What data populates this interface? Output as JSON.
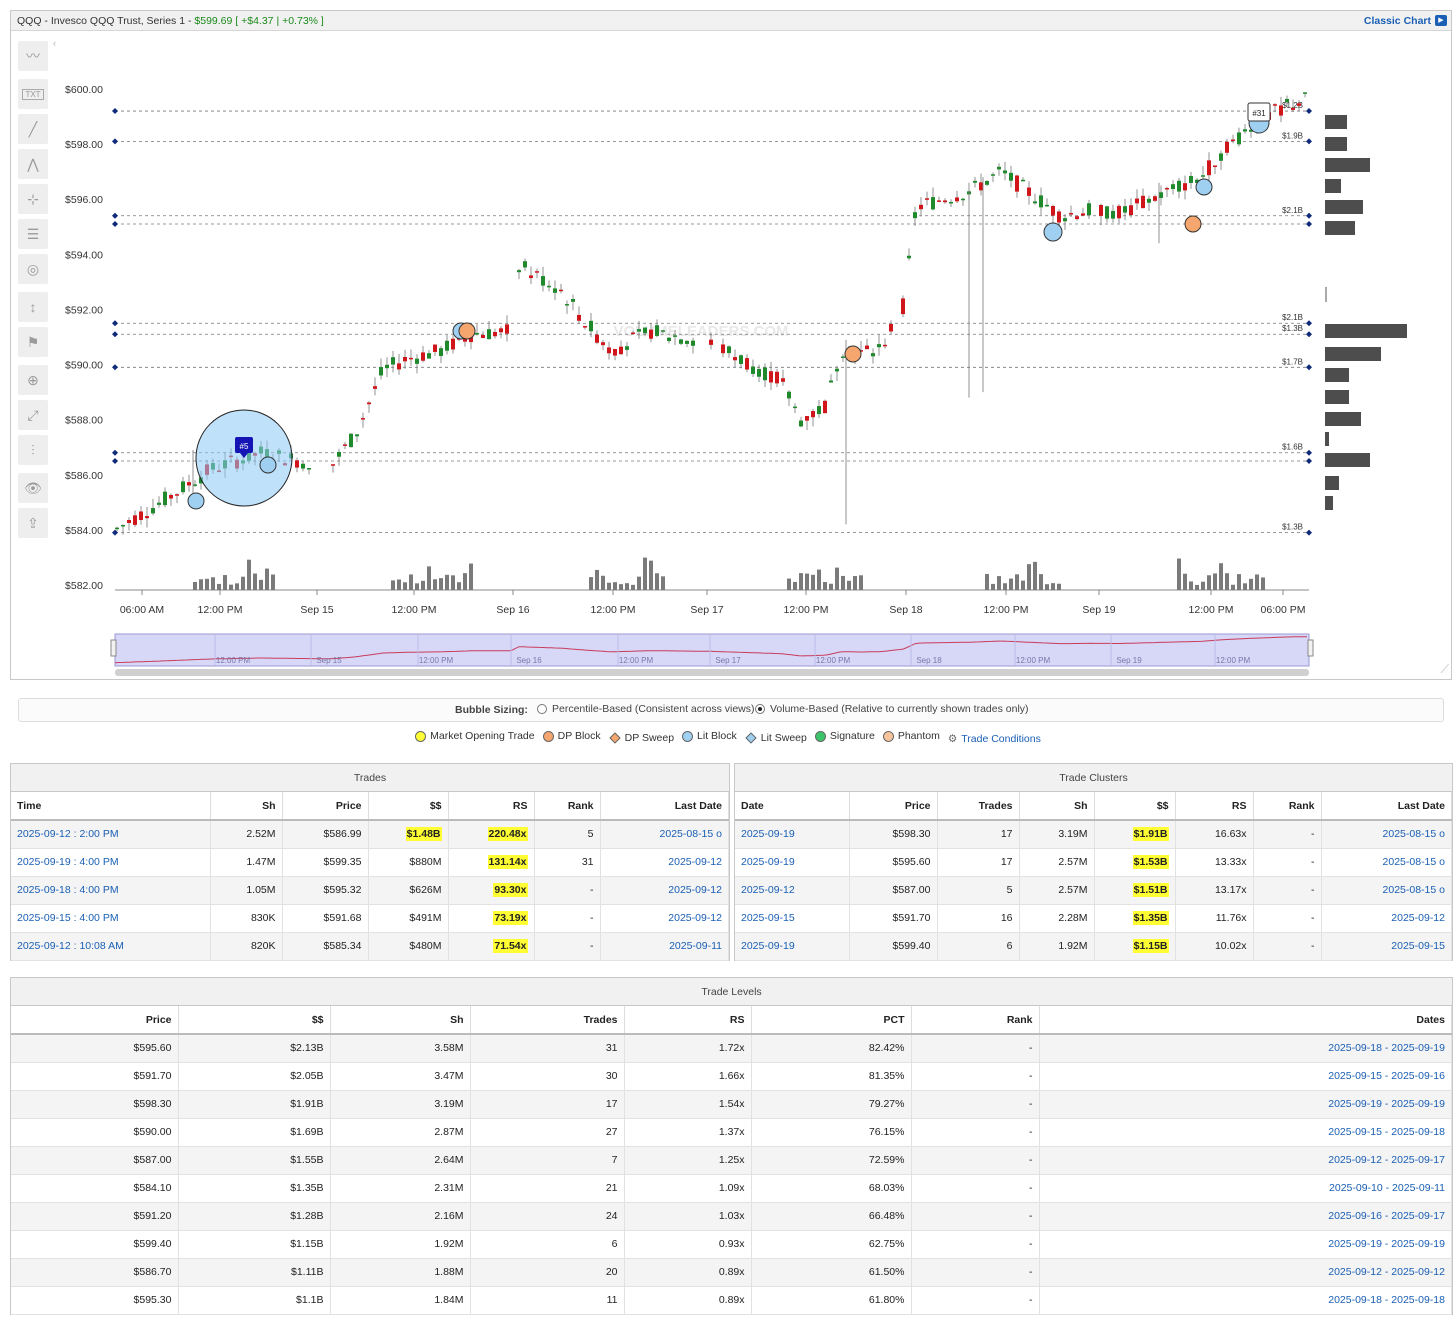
{
  "header": {
    "symbol_name": "QQQ - Invesco QQQ Trust, Series 1 - ",
    "price": "$599.69",
    "change": "[ +$4.37 | +0.73% ]",
    "classic_chart": "Classic Chart"
  },
  "chart_data": {
    "type": "candlestick",
    "y_ticks": [
      "$600.00",
      "$598.00",
      "$596.00",
      "$594.00",
      "$592.00",
      "$590.00",
      "$588.00",
      "$586.00",
      "$584.00",
      "$582.00"
    ],
    "x_ticks": [
      "06:00 AM",
      "12:00 PM",
      "Sep 15",
      "12:00 PM",
      "Sep 16",
      "12:00 PM",
      "Sep 17",
      "12:00 PM",
      "Sep 18",
      "12:00 PM",
      "Sep 19",
      "12:00 PM",
      "06:00 PM"
    ],
    "navigator_ticks": [
      "12:00 PM",
      "Sep 15",
      "12:00 PM",
      "Sep 16",
      "12:00 PM",
      "Sep 17",
      "12:00 PM",
      "Sep 18",
      "12:00 PM",
      "Sep 19",
      "12:00 PM"
    ],
    "ylim": [
      582,
      600
    ],
    "levels": [
      {
        "price": 599.2,
        "label": "$1.2B"
      },
      {
        "price": 598.1,
        "label": "$1.9B"
      },
      {
        "price": 595.4,
        "label": "$2.1B"
      },
      {
        "price": 595.1,
        "label": ""
      },
      {
        "price": 591.5,
        "label": "$2.1B"
      },
      {
        "price": 591.1,
        "label": "$1.3B"
      },
      {
        "price": 589.9,
        "label": "$1.7B"
      },
      {
        "price": 586.8,
        "label": "$1.6B"
      },
      {
        "price": 586.5,
        "label": ""
      },
      {
        "price": 583.9,
        "label": "$1.3B"
      }
    ],
    "markers": [
      {
        "label": "#5",
        "price": 586.9
      },
      {
        "label": "#31",
        "price": 599.6
      }
    ],
    "watermark": "VOLUMELEADERS.COM"
  },
  "bubble_sizing": {
    "label": "Bubble Sizing:",
    "option1": "Percentile-Based (Consistent across views)",
    "option2": "Volume-Based (Relative to currently shown trades only)"
  },
  "legend": [
    {
      "label": "Market Opening Trade",
      "color": "#ffff33",
      "shape": "circle"
    },
    {
      "label": "DP Block",
      "color": "#f5a66e",
      "shape": "circle"
    },
    {
      "label": "DP Sweep",
      "color": "#f5a66e",
      "shape": "diamond"
    },
    {
      "label": "Lit Block",
      "color": "#9fd0f2",
      "shape": "circle"
    },
    {
      "label": "Lit Sweep",
      "color": "#9fd0f2",
      "shape": "diamond"
    },
    {
      "label": "Signature",
      "color": "#3cc46a",
      "shape": "circle"
    },
    {
      "label": "Phantom",
      "color": "#f5c49a",
      "shape": "phantom"
    },
    {
      "label": "Trade Conditions",
      "shape": "gear"
    }
  ],
  "trades": {
    "title": "Trades",
    "columns": [
      "Time",
      "Sh",
      "Price",
      "$$",
      "RS",
      "Rank",
      "Last Date"
    ],
    "rows": [
      [
        "2025-09-12 : 2:00 PM",
        "2.52M",
        "$586.99",
        "$1.48B",
        "220.48x",
        "5",
        "2025-08-15 o"
      ],
      [
        "2025-09-19 : 4:00 PM",
        "1.47M",
        "$599.35",
        "$880M",
        "131.14x",
        "31",
        "2025-09-12"
      ],
      [
        "2025-09-18 : 4:00 PM",
        "1.05M",
        "$595.32",
        "$626M",
        "93.30x",
        "-",
        "2025-09-12"
      ],
      [
        "2025-09-15 : 4:00 PM",
        "830K",
        "$591.68",
        "$491M",
        "73.19x",
        "-",
        "2025-09-12"
      ],
      [
        "2025-09-12 : 10:08 AM",
        "820K",
        "$585.34",
        "$480M",
        "71.54x",
        "-",
        "2025-09-11"
      ]
    ]
  },
  "clusters": {
    "title": "Trade Clusters",
    "columns": [
      "Date",
      "Price",
      "Trades",
      "Sh",
      "$$",
      "RS",
      "Rank",
      "Last Date"
    ],
    "rows": [
      [
        "2025-09-19",
        "$598.30",
        "17",
        "3.19M",
        "$1.91B",
        "16.63x",
        "-",
        "2025-08-15 o"
      ],
      [
        "2025-09-19",
        "$595.60",
        "17",
        "2.57M",
        "$1.53B",
        "13.33x",
        "-",
        "2025-08-15 o"
      ],
      [
        "2025-09-12",
        "$587.00",
        "5",
        "2.57M",
        "$1.51B",
        "13.17x",
        "-",
        "2025-08-15 o"
      ],
      [
        "2025-09-15",
        "$591.70",
        "16",
        "2.28M",
        "$1.35B",
        "11.76x",
        "-",
        "2025-09-12"
      ],
      [
        "2025-09-19",
        "$599.40",
        "6",
        "1.92M",
        "$1.15B",
        "10.02x",
        "-",
        "2025-09-15"
      ]
    ]
  },
  "levels_table": {
    "title": "Trade Levels",
    "columns": [
      "Price",
      "$$",
      "Sh",
      "Trades",
      "RS",
      "PCT",
      "Rank",
      "Dates"
    ],
    "rows": [
      [
        "$595.60",
        "$2.13B",
        "3.58M",
        "31",
        "1.72x",
        "82.42%",
        "-",
        "2025-09-18 - 2025-09-19"
      ],
      [
        "$591.70",
        "$2.05B",
        "3.47M",
        "30",
        "1.66x",
        "81.35%",
        "-",
        "2025-09-15 - 2025-09-16"
      ],
      [
        "$598.30",
        "$1.91B",
        "3.19M",
        "17",
        "1.54x",
        "79.27%",
        "-",
        "2025-09-19 - 2025-09-19"
      ],
      [
        "$590.00",
        "$1.69B",
        "2.87M",
        "27",
        "1.37x",
        "76.15%",
        "-",
        "2025-09-15 - 2025-09-18"
      ],
      [
        "$587.00",
        "$1.55B",
        "2.64M",
        "7",
        "1.25x",
        "72.59%",
        "-",
        "2025-09-12 - 2025-09-17"
      ],
      [
        "$584.10",
        "$1.35B",
        "2.31M",
        "21",
        "1.09x",
        "68.03%",
        "-",
        "2025-09-10 - 2025-09-11"
      ],
      [
        "$591.20",
        "$1.28B",
        "2.16M",
        "24",
        "1.03x",
        "66.48%",
        "-",
        "2025-09-16 - 2025-09-17"
      ],
      [
        "$599.40",
        "$1.15B",
        "1.92M",
        "6",
        "0.93x",
        "62.75%",
        "-",
        "2025-09-19 - 2025-09-19"
      ],
      [
        "$586.70",
        "$1.11B",
        "1.88M",
        "20",
        "0.89x",
        "61.50%",
        "-",
        "2025-09-12 - 2025-09-12"
      ],
      [
        "$595.30",
        "$1.1B",
        "1.84M",
        "11",
        "0.89x",
        "61.80%",
        "-",
        "2025-09-18 - 2025-09-18"
      ]
    ]
  }
}
